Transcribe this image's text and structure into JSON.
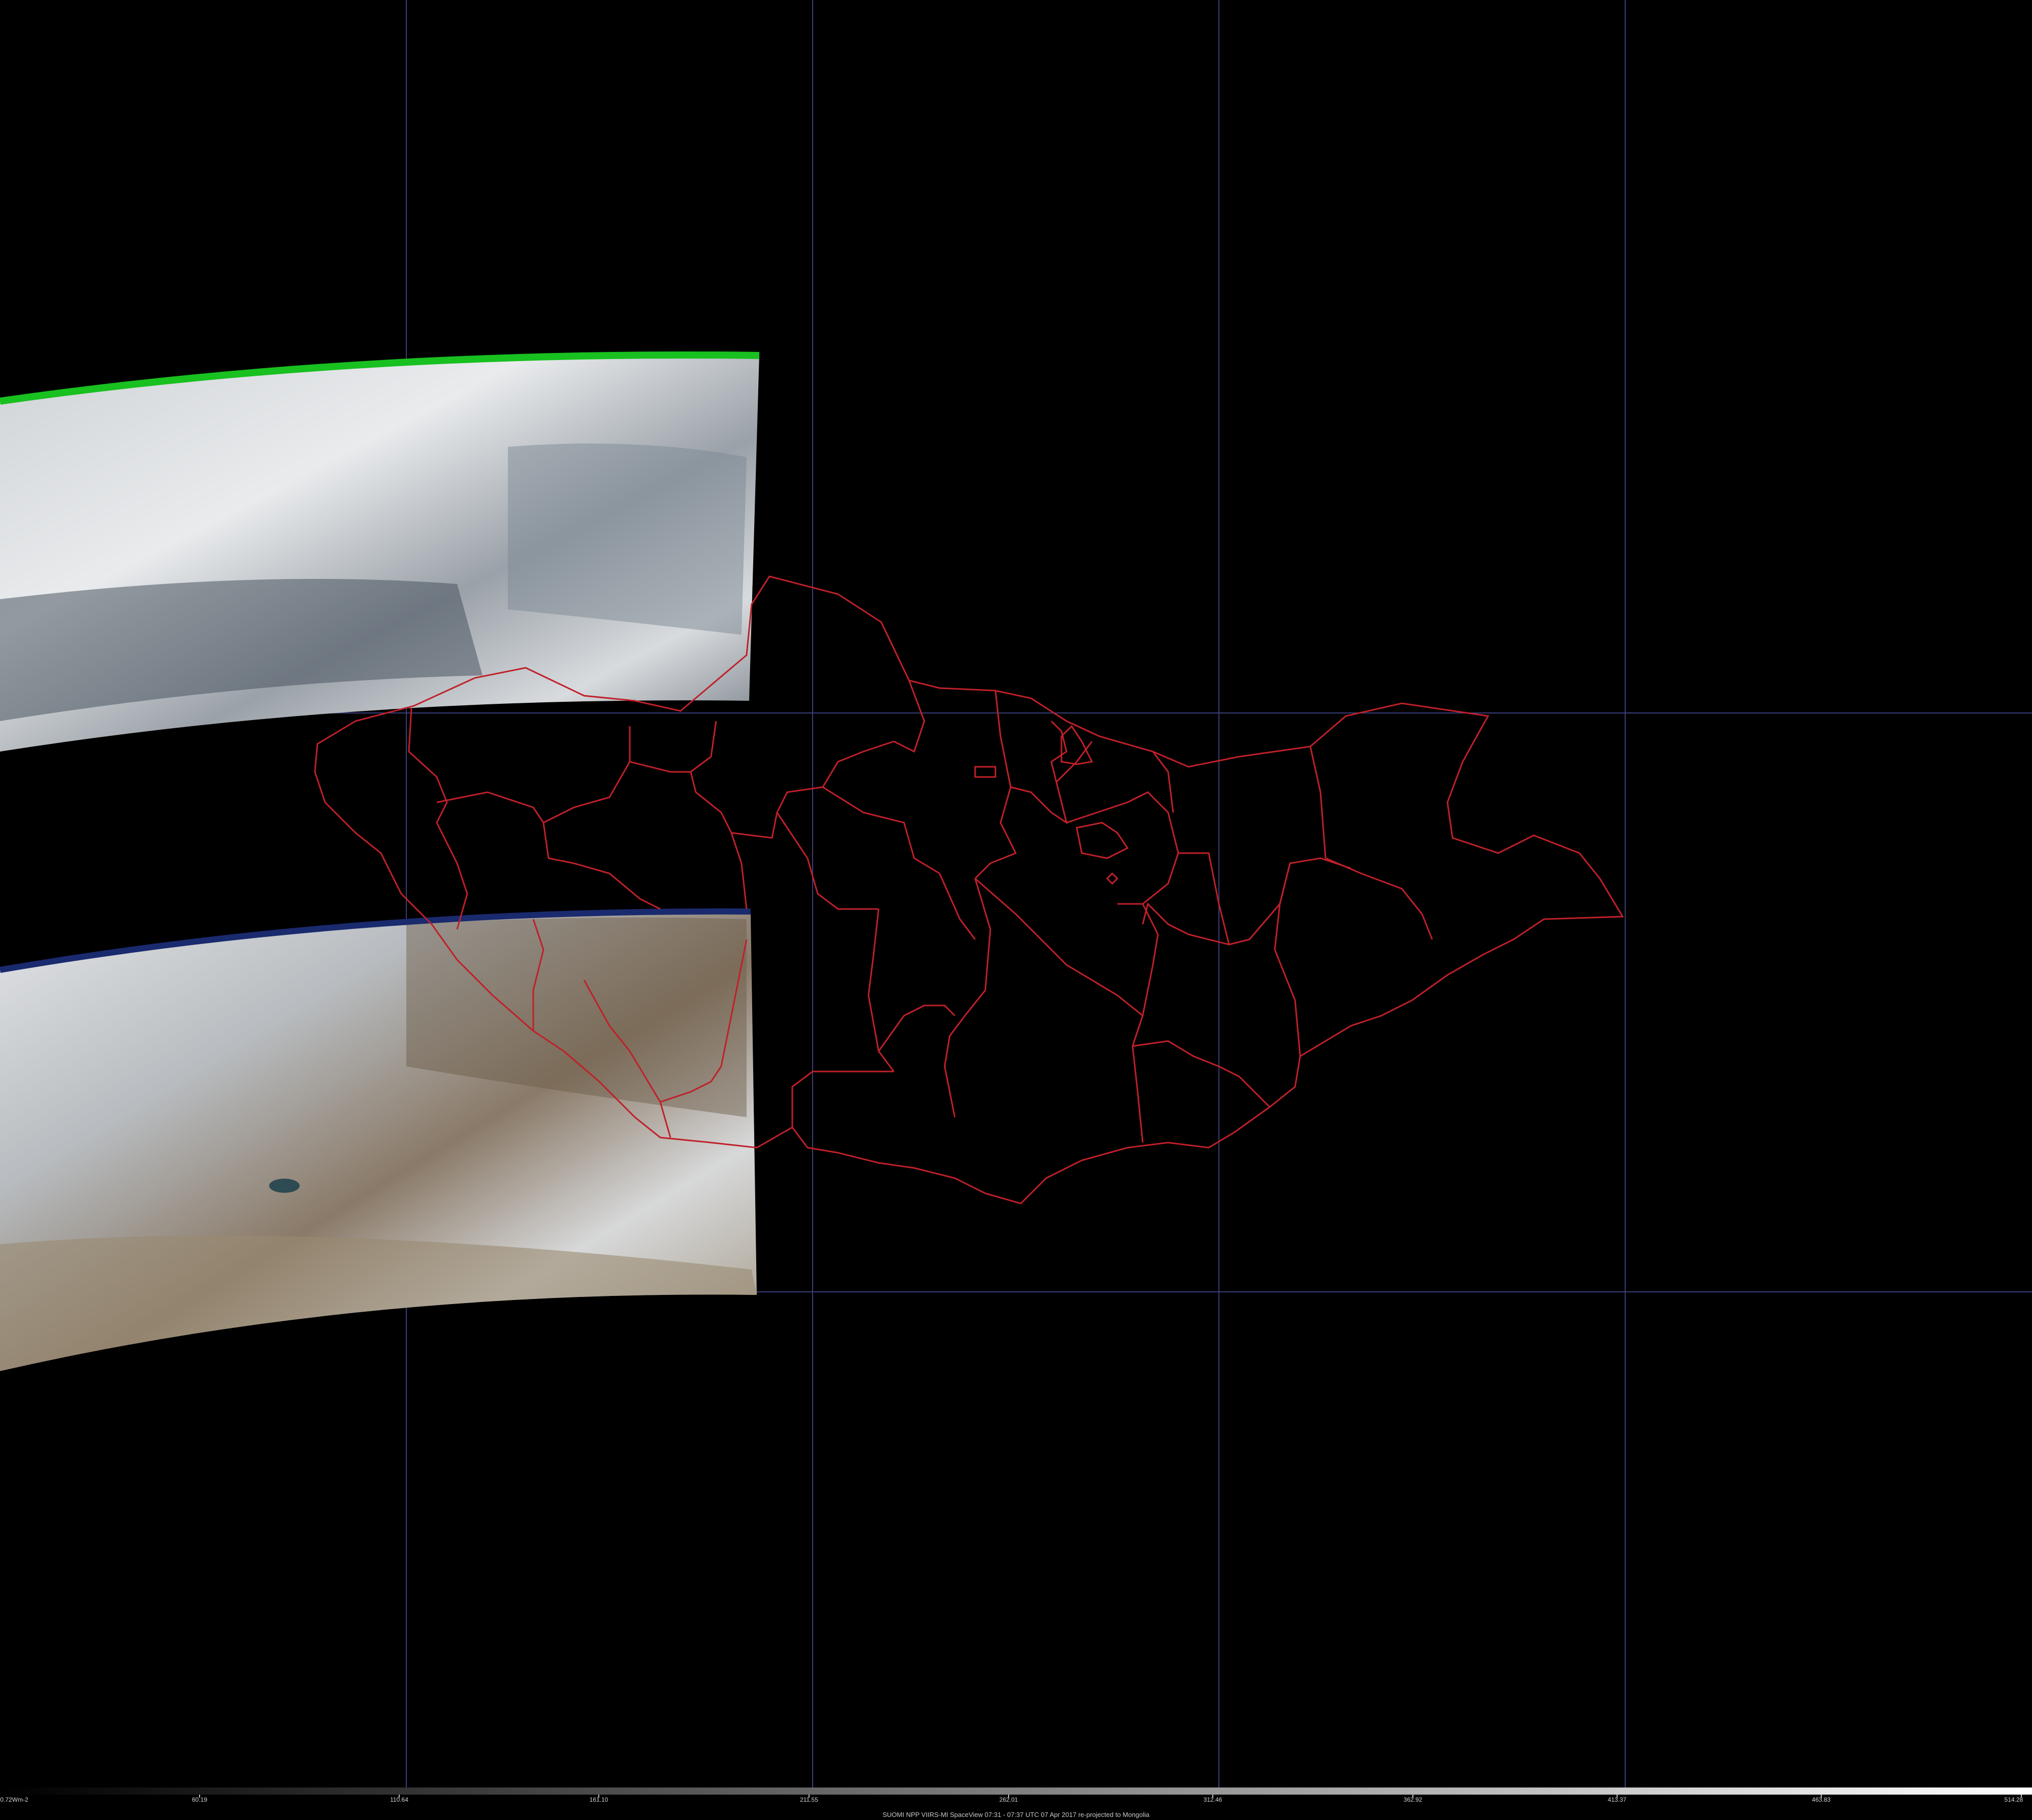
{
  "title": "SUOMI NPP VIIRS-MI SpaceView 07:31 - 07:37 UTC 07 Apr 2017 re-projected to Mongolia",
  "colorbar": {
    "unit_label": "0.72Wm-2",
    "ticks": [
      "60.19",
      "110.64",
      "161.10",
      "211.55",
      "262.01",
      "312.46",
      "362.92",
      "413.37",
      "463.83",
      "514.28"
    ],
    "gradient_start": "#000000",
    "gradient_end": "#ffffff"
  },
  "colors": {
    "background": "#000000",
    "gridline": "#3a3f7a",
    "admin_border": "#c0202a",
    "swath_edge_top": "#18c020",
    "swath_edge_bottom": "#1a2a6e"
  },
  "layers": {
    "swaths": 2,
    "admin_borders": "Mongolia aimag boundaries"
  }
}
